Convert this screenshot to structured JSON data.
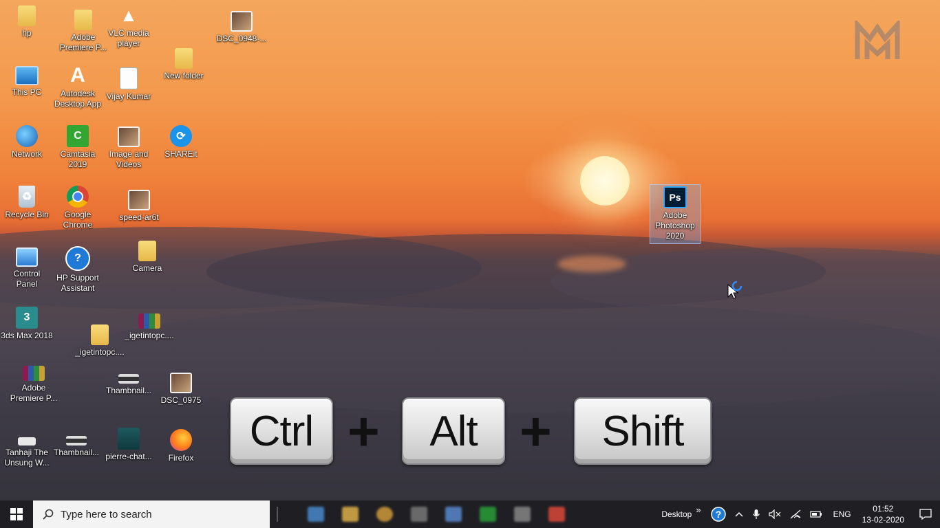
{
  "desktop_icons": [
    {
      "id": "hp",
      "label": "hp",
      "icon": "user-folder-icon"
    },
    {
      "id": "adobe-premiere-folder",
      "label": "Adobe\nPremiere P...",
      "icon": "folder-icon"
    },
    {
      "id": "vlc",
      "label": "VLC media\nplayer",
      "icon": "vlc-cone-icon"
    },
    {
      "id": "dsc0948",
      "label": "DSC_0948-...",
      "icon": "image-icon"
    },
    {
      "id": "this-pc",
      "label": "This PC",
      "icon": "monitor-icon"
    },
    {
      "id": "autodesk",
      "label": "Autodesk\nDesktop App",
      "icon": "autodesk-icon"
    },
    {
      "id": "vijay",
      "label": "Vijay Kumar",
      "icon": "document-icon"
    },
    {
      "id": "new-folder",
      "label": "New folder",
      "icon": "folder-icon"
    },
    {
      "id": "network",
      "label": "Network",
      "icon": "globe-icon"
    },
    {
      "id": "camtasia",
      "label": "Camtasia\n2019",
      "icon": "camtasia-icon"
    },
    {
      "id": "image-videos",
      "label": "Image and\nVideos",
      "icon": "folder-icon"
    },
    {
      "id": "shareit",
      "label": "SHAREit",
      "icon": "shareit-icon"
    },
    {
      "id": "recycle",
      "label": "Recycle Bin",
      "icon": "recycle-bin-icon"
    },
    {
      "id": "chrome",
      "label": "Google\nChrome",
      "icon": "chrome-icon"
    },
    {
      "id": "speed",
      "label": "speed-ar6t",
      "icon": "image-icon"
    },
    {
      "id": "control-panel",
      "label": "Control\nPanel",
      "icon": "control-panel-icon"
    },
    {
      "id": "hp-support",
      "label": "HP Support\nAssistant",
      "icon": "help-icon"
    },
    {
      "id": "camera",
      "label": "Camera",
      "icon": "folder-icon"
    },
    {
      "id": "3dsmax",
      "label": "3ds Max 2018",
      "icon": "3ds-max-icon"
    },
    {
      "id": "igetintopc-folder",
      "label": "_igetintopc....",
      "icon": "folder-icon"
    },
    {
      "id": "igetintopc-rar",
      "label": "_igetintopc....",
      "icon": "winrar-icon"
    },
    {
      "id": "adobe-premiere-rar",
      "label": "Adobe\nPremiere P...",
      "icon": "winrar-icon"
    },
    {
      "id": "thumbnail1",
      "label": "Thambnail...",
      "icon": "image-icon"
    },
    {
      "id": "dsc0975",
      "label": "DSC_0975",
      "icon": "image-icon"
    },
    {
      "id": "tanhaji",
      "label": "Tanhaji The\nUnsung W...",
      "icon": "video-icon"
    },
    {
      "id": "thumbnail2",
      "label": "Thambnail...",
      "icon": "image-icon"
    },
    {
      "id": "pierre",
      "label": "pierre-chat...",
      "icon": "image-icon"
    },
    {
      "id": "firefox",
      "label": "Firefox",
      "icon": "firefox-icon"
    },
    {
      "id": "photoshop",
      "label": "Adobe\nPhotoshop\n2020",
      "icon": "photoshop-icon",
      "selected": true
    }
  ],
  "keys": {
    "ctrl": "Ctrl",
    "alt": "Alt",
    "shift": "Shift",
    "plus": "+"
  },
  "taskbar": {
    "search_placeholder": "Type here to search",
    "apps": [
      {
        "name": "file-explorer-icon",
        "color": "#4a8fd6"
      },
      {
        "name": "folder-icon",
        "color": "#e8b84a"
      },
      {
        "name": "chrome-icon",
        "color": "#d9a13a"
      },
      {
        "name": "camera-icon",
        "color": "#7c7c7c"
      },
      {
        "name": "store-icon",
        "color": "#5b8fd8"
      },
      {
        "name": "camtasia-icon",
        "color": "#2aa53a"
      },
      {
        "name": "app-icon",
        "color": "#8c8c8c"
      },
      {
        "name": "recorder-icon",
        "color": "#e64a3a"
      }
    ],
    "tray": {
      "desktop_label": "Desktop",
      "overflow": "»",
      "language": "ENG",
      "time": "01:52",
      "date": "13-02-2020"
    }
  },
  "photoshop_glyph": "Ps",
  "colors": {
    "taskbar_bg": "#1f1f23",
    "search_bg": "#f3f3f3",
    "selection": "#78aae6"
  }
}
